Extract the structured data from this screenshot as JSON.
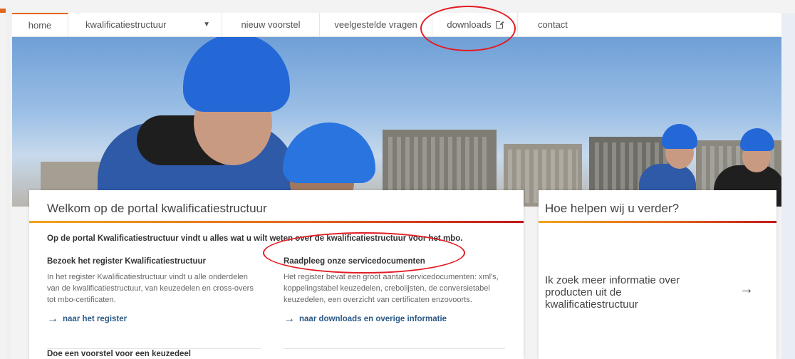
{
  "nav": {
    "items": [
      {
        "label": "home",
        "active": true
      },
      {
        "label": "kwalificatiestructuur",
        "has_dropdown": true
      },
      {
        "label": "nieuw voorstel"
      },
      {
        "label": "veelgestelde vragen"
      },
      {
        "label": "downloads",
        "external": true
      },
      {
        "label": "contact"
      }
    ]
  },
  "main_card": {
    "title": "Welkom op de portal kwalificatiestructuur",
    "intro": "Op de portal Kwalificatiestructuur vindt u alles wat u wilt weten over de kwalificatiestructuur voor het mbo.",
    "left": {
      "heading": "Bezoek het register Kwalificatiestructuur",
      "text": "In het register Kwalificatiestructuur vindt u alle onderdelen van de kwalificatiestructuur, van keuzedelen en cross-overs tot mbo-certificaten.",
      "link": "naar het register"
    },
    "right": {
      "heading": "Raadpleeg onze servicedocumenten",
      "text": "Het register bevat een groot aantal servicedocumenten: xml's, koppelingstabel keuzedelen, crebolijsten, de conversietabel keuzedelen, een overzicht van certificaten enzovoorts.",
      "link": "naar downloads en overige informatie"
    },
    "section2_heading": "Doe een voorstel voor een keuzedeel"
  },
  "side_card": {
    "title": "Hoe helpen wij u verder?",
    "body": "Ik zoek meer informatie over producten uit de kwalificatiestructuur"
  },
  "colors": {
    "accent": "#e2661c",
    "link": "#2d5a87",
    "annotation": "#e31b23"
  }
}
